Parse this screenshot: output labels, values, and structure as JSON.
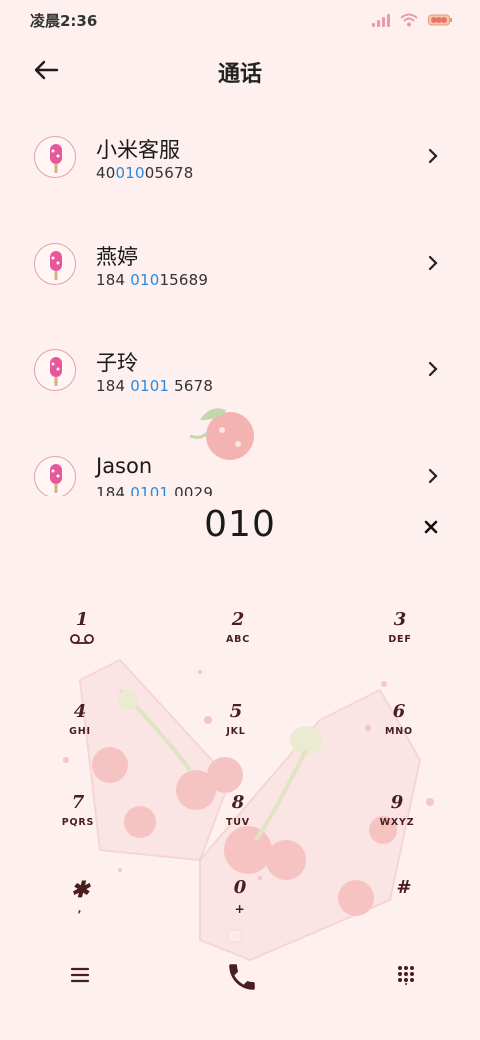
{
  "status_bar": {
    "time": "凌晨2:36",
    "icons": [
      "signal-icon",
      "wifi-icon",
      "battery-icon"
    ]
  },
  "header": {
    "back_icon": "arrow-left-icon",
    "title": "通话"
  },
  "contacts": [
    {
      "name": "小米客服",
      "number_pre": "40",
      "number_hl": "010",
      "number_post": "05678"
    },
    {
      "name": "燕婷",
      "number_pre": "184 ",
      "number_hl": "010",
      "number_post": "15689"
    },
    {
      "name": "子玲",
      "number_pre": "184 ",
      "number_hl": "0101",
      "number_post": " 5678"
    },
    {
      "name": "Jason",
      "number_pre": "184 ",
      "number_hl": "0101",
      "number_post": " 0029"
    }
  ],
  "dialer": {
    "input": "010",
    "clear_icon": "close-icon"
  },
  "keypad": [
    {
      "digit": "1",
      "letters": "",
      "icon": "voicemail-icon"
    },
    {
      "digit": "2",
      "letters": "ABC"
    },
    {
      "digit": "3",
      "letters": "DEF"
    },
    {
      "digit": "4",
      "letters": "GHI"
    },
    {
      "digit": "5",
      "letters": "JKL"
    },
    {
      "digit": "6",
      "letters": "MNO"
    },
    {
      "digit": "7",
      "letters": "PQRS"
    },
    {
      "digit": "8",
      "letters": "TUV"
    },
    {
      "digit": "9",
      "letters": "WXYZ"
    },
    {
      "digit": "✱",
      "letters": ","
    },
    {
      "digit": "0",
      "letters": "+"
    },
    {
      "digit": "#",
      "letters": ""
    }
  ],
  "bottom_bar": {
    "menu_icon": "menu-icon",
    "call_icon": "phone-icon",
    "keypad_icon": "dialpad-icon"
  },
  "colors": {
    "background": "#fdf0ee",
    "highlight": "#2a8ae0",
    "keypad_text": "#4a1d1f",
    "accent_pink": "#e89aa8"
  }
}
